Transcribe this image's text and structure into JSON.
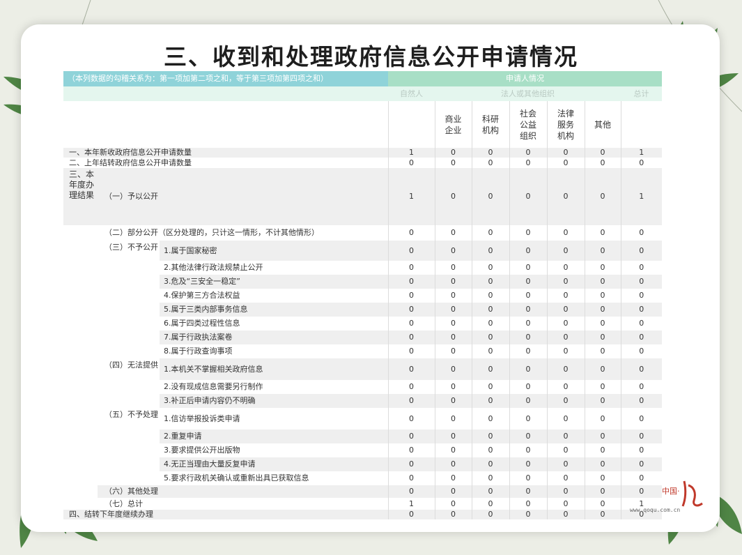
{
  "title": "三、收到和处理政府信息公开申请情况",
  "table": {
    "note": "（本列数据的勾稽关系为：第一项加第二项之和，等于第三项加第四项之和）",
    "applicant_header": "申请人情况",
    "natural_person": "自然人",
    "legal_persons": "法人或其他组织",
    "total": "总计",
    "sub_cols": [
      "商业\n企业",
      "科研\n机构",
      "社会\n公益\n组织",
      "法律\n服务\n机构",
      "其他"
    ],
    "rows": [
      {
        "label": "一、本年新收政府信息公开申请数量",
        "values": [
          "1",
          "0",
          "0",
          "0",
          "0",
          "0",
          "1"
        ]
      },
      {
        "label": "二、上年结转政府信息公开申请数量",
        "values": [
          "0",
          "0",
          "0",
          "0",
          "0",
          "0",
          "0"
        ]
      },
      {
        "group": "三、本年度办理结果",
        "label": "（一）予以公开",
        "values": [
          "1",
          "0",
          "0",
          "0",
          "0",
          "0",
          "1"
        ]
      },
      {
        "label": "（二）部分公开（区分处理的，只计这一情形，不计其他情形）",
        "values": [
          "0",
          "0",
          "0",
          "0",
          "0",
          "0",
          "0"
        ]
      },
      {
        "subgroup": "（三）不予公开",
        "label": "1.属于国家秘密",
        "values": [
          "0",
          "0",
          "0",
          "0",
          "0",
          "0",
          "0"
        ]
      },
      {
        "label": "2.其他法律行政法规禁止公开",
        "values": [
          "0",
          "0",
          "0",
          "0",
          "0",
          "0",
          "0"
        ]
      },
      {
        "label": "3.危及“三安全一稳定”",
        "values": [
          "0",
          "0",
          "0",
          "0",
          "0",
          "0",
          "0"
        ]
      },
      {
        "label": "4.保护第三方合法权益",
        "values": [
          "0",
          "0",
          "0",
          "0",
          "0",
          "0",
          "0"
        ]
      },
      {
        "label": "5.属于三类内部事务信息",
        "values": [
          "0",
          "0",
          "0",
          "0",
          "0",
          "0",
          "0"
        ]
      },
      {
        "label": "6.属于四类过程性信息",
        "values": [
          "0",
          "0",
          "0",
          "0",
          "0",
          "0",
          "0"
        ]
      },
      {
        "label": "7.属于行政执法案卷",
        "values": [
          "0",
          "0",
          "0",
          "0",
          "0",
          "0",
          "0"
        ]
      },
      {
        "label": "8.属于行政查询事项",
        "values": [
          "0",
          "0",
          "0",
          "0",
          "0",
          "0",
          "0"
        ]
      },
      {
        "subgroup": "（四）无法提供",
        "label": "1.本机关不掌握相关政府信息",
        "values": [
          "0",
          "0",
          "0",
          "0",
          "0",
          "0",
          "0"
        ]
      },
      {
        "label": "2.没有现成信息需要另行制作",
        "values": [
          "0",
          "0",
          "0",
          "0",
          "0",
          "0",
          "0"
        ]
      },
      {
        "label": "3.补正后申请内容仍不明确",
        "values": [
          "0",
          "0",
          "0",
          "0",
          "0",
          "0",
          "0"
        ]
      },
      {
        "subgroup": "（五）不予处理",
        "label": "1.信访举报投诉类申请",
        "values": [
          "0",
          "0",
          "0",
          "0",
          "0",
          "0",
          "0"
        ]
      },
      {
        "label": "2.重复申请",
        "values": [
          "0",
          "0",
          "0",
          "0",
          "0",
          "0",
          "0"
        ]
      },
      {
        "label": "3.要求提供公开出版物",
        "values": [
          "0",
          "0",
          "0",
          "0",
          "0",
          "0",
          "0"
        ]
      },
      {
        "label": "4.无正当理由大量反复申请",
        "values": [
          "0",
          "0",
          "0",
          "0",
          "0",
          "0",
          "0"
        ]
      },
      {
        "label": "5.要求行政机关确认或重新出具已获取信息",
        "values": [
          "0",
          "0",
          "0",
          "0",
          "0",
          "0",
          "0"
        ]
      },
      {
        "label": "（六）其他处理",
        "values": [
          "0",
          "0",
          "0",
          "0",
          "0",
          "0",
          "0"
        ]
      },
      {
        "label": "（七）总计",
        "values": [
          "1",
          "0",
          "0",
          "0",
          "0",
          "0",
          "1"
        ]
      },
      {
        "label": "四、结转下年度继续办理",
        "values": [
          "0",
          "0",
          "0",
          "0",
          "0",
          "0",
          "0"
        ]
      }
    ]
  },
  "watermark": {
    "brand": "中国·",
    "url": "www.qoqu.com.cn"
  }
}
